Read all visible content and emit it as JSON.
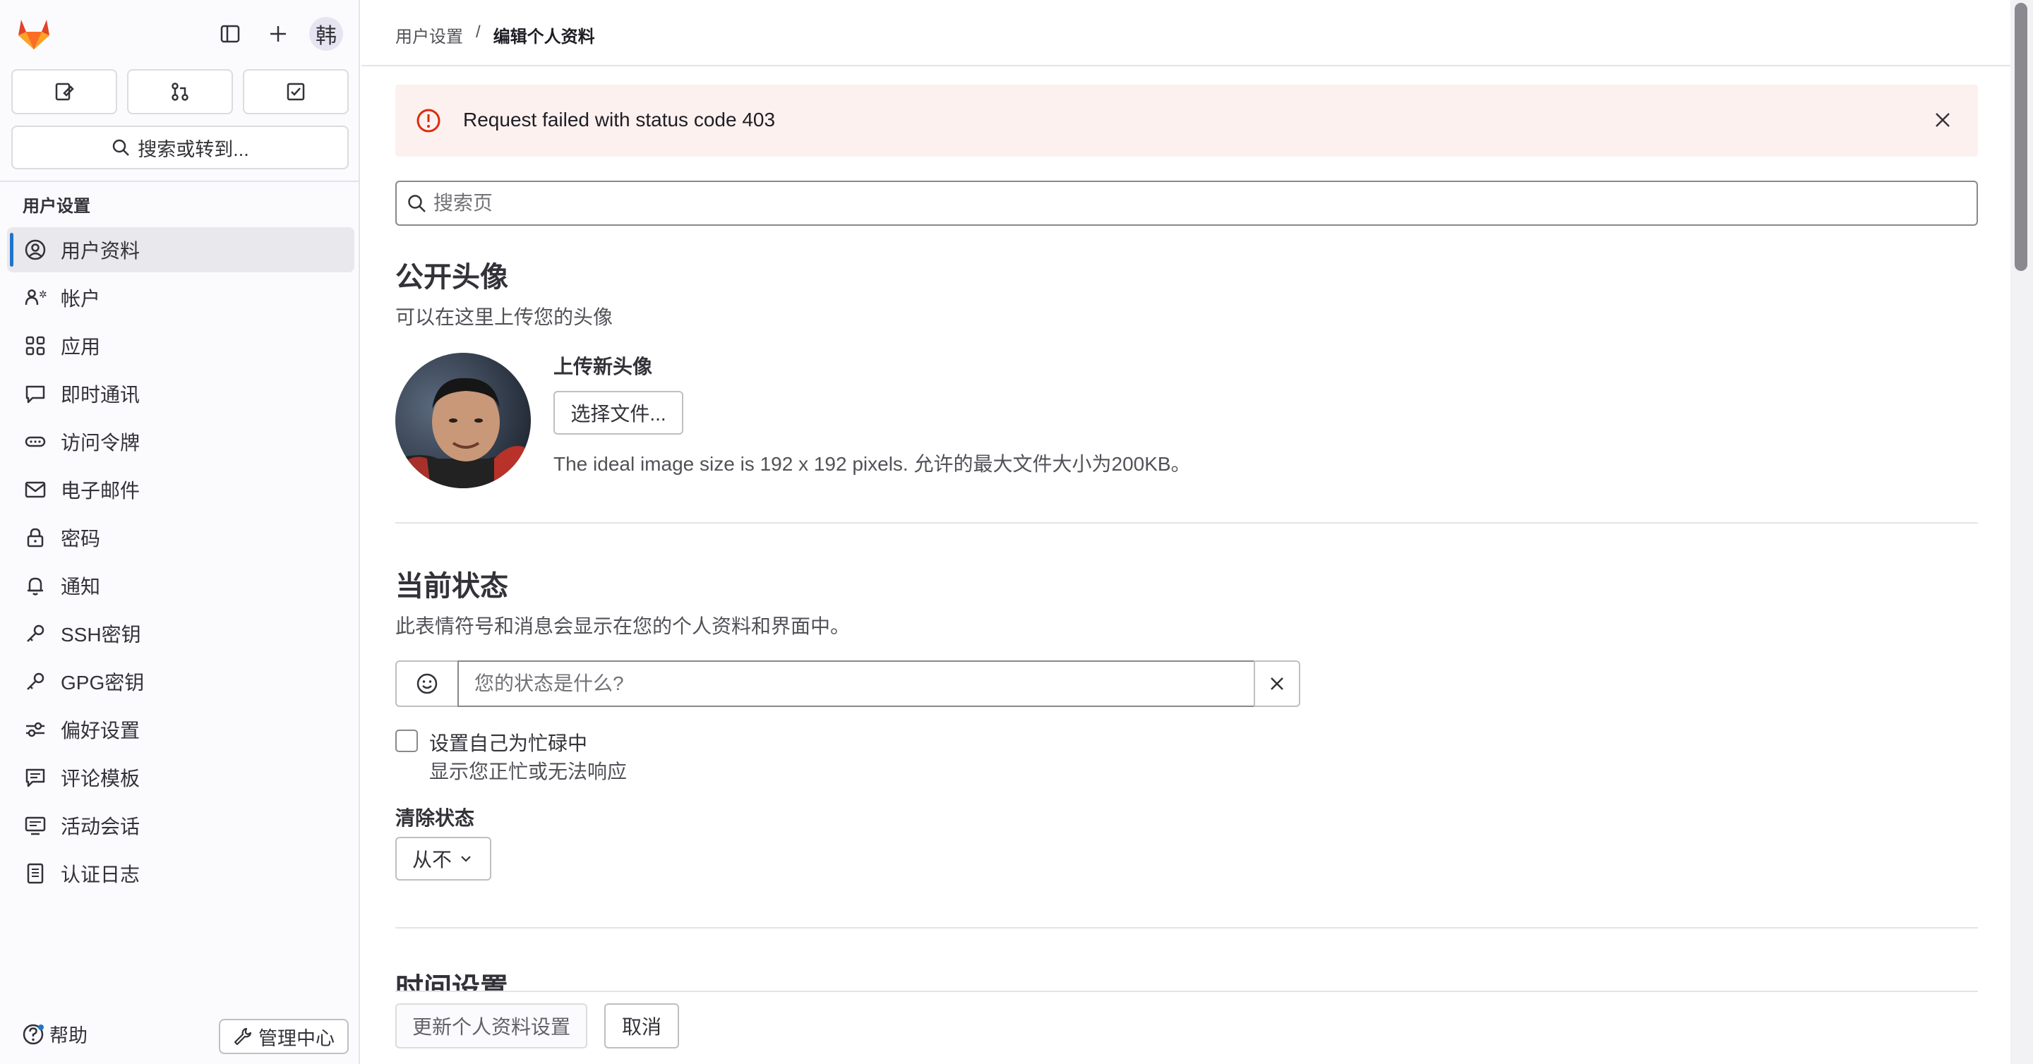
{
  "sidebar": {
    "avatar_initial": "韩",
    "search_label": "搜索或转到...",
    "section_title": "用户设置",
    "items": [
      {
        "label": "用户资料",
        "icon": "profile-icon"
      },
      {
        "label": "帐户",
        "icon": "account-icon"
      },
      {
        "label": "应用",
        "icon": "applications-icon"
      },
      {
        "label": "即时通讯",
        "icon": "chat-icon"
      },
      {
        "label": "访问令牌",
        "icon": "token-icon"
      },
      {
        "label": "电子邮件",
        "icon": "mail-icon"
      },
      {
        "label": "密码",
        "icon": "lock-icon"
      },
      {
        "label": "通知",
        "icon": "bell-icon"
      },
      {
        "label": "SSH密钥",
        "icon": "key-icon"
      },
      {
        "label": "GPG密钥",
        "icon": "key-icon"
      },
      {
        "label": "偏好设置",
        "icon": "preferences-icon"
      },
      {
        "label": "评论模板",
        "icon": "comment-icon"
      },
      {
        "label": "活动会话",
        "icon": "monitor-icon"
      },
      {
        "label": "认证日志",
        "icon": "log-icon"
      }
    ],
    "help_label": "帮助",
    "admin_label": "管理中心"
  },
  "breadcrumb": {
    "parent": "用户设置",
    "separator": "/",
    "current": "编辑个人资料"
  },
  "alert": {
    "message": "Request failed with status code 403"
  },
  "search": {
    "placeholder": "搜索页"
  },
  "avatar_section": {
    "title": "公开头像",
    "description": "可以在这里上传您的头像",
    "upload_title": "上传新头像",
    "choose_button": "选择文件...",
    "hint": "The ideal image size is 192 x 192 pixels. 允许的最大文件大小为200KB。"
  },
  "status_section": {
    "title": "当前状态",
    "description": "此表情符号和消息会显示在您的个人资料和界面中。",
    "input_placeholder": "您的状态是什么?",
    "busy_label": "设置自己为忙碌中",
    "busy_help": "显示您正忙或无法响应",
    "clear_label": "清除状态",
    "clear_value": "从不"
  },
  "time_section": {
    "title": "时间设置"
  },
  "footer": {
    "update_button": "更新个人资料设置",
    "cancel_button": "取消"
  },
  "colors": {
    "accent": "#1f75cb",
    "alert_bg": "#fcf1ef",
    "alert_icon": "#dd2b0e",
    "logo_orange": "#fc6d26"
  }
}
